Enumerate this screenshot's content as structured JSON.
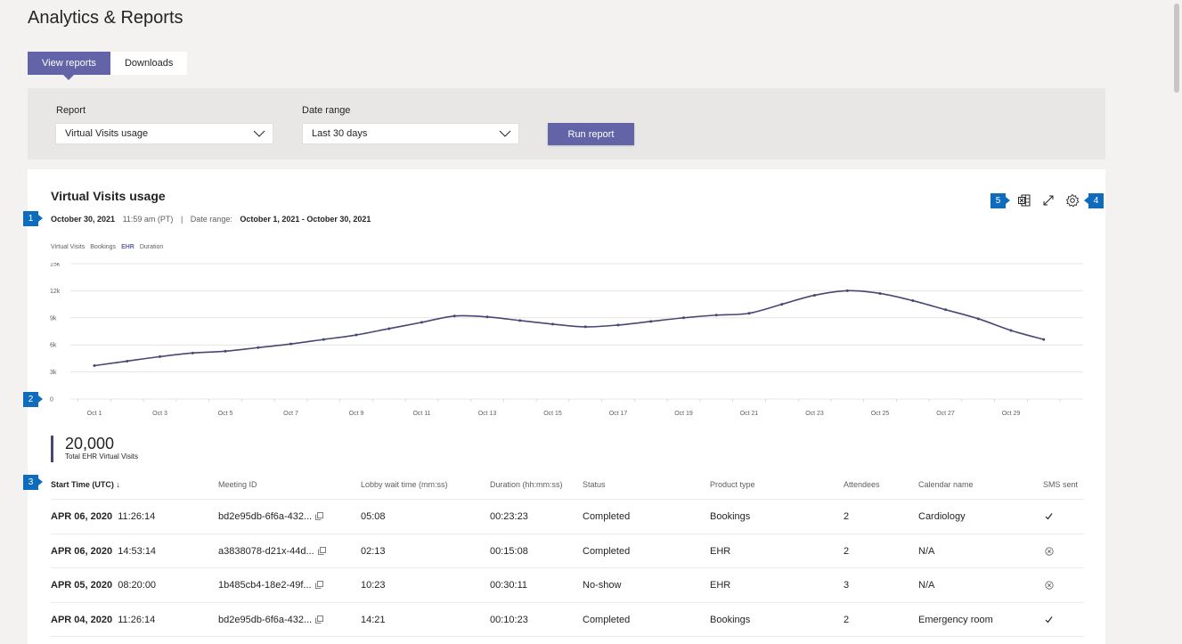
{
  "page": {
    "title": "Analytics & Reports"
  },
  "tabs": [
    {
      "label": "View reports",
      "active": true
    },
    {
      "label": "Downloads",
      "active": false
    }
  ],
  "filters": {
    "report_label": "Report",
    "report_value": "Virtual Visits usage",
    "date_label": "Date range",
    "date_value": "Last 30 days",
    "run_label": "Run report"
  },
  "card": {
    "title": "Virtual Visits usage",
    "date": "October 30, 2021",
    "time": "11:59 am (PT)",
    "range_label": "Date range:",
    "range_value": "October 1, 2021 - October 30, 2021",
    "icons": [
      "excel-icon",
      "expand-icon",
      "settings-icon"
    ]
  },
  "badges": [
    "1",
    "2",
    "3",
    "4",
    "5"
  ],
  "legend": [
    {
      "label": "Virtual Visits",
      "active": false
    },
    {
      "label": "Bookings",
      "active": false
    },
    {
      "label": "EHR",
      "active": true
    },
    {
      "label": "Duration",
      "active": false
    }
  ],
  "chart_data": {
    "type": "line",
    "ylim": [
      0,
      15000
    ],
    "yticks": [
      "15k",
      "12k",
      "9k",
      "6k",
      "3k",
      "0"
    ],
    "xticks": [
      "Oct 1",
      "Oct 3",
      "Oct 5",
      "Oct 7",
      "Oct 9",
      "Oct 11",
      "Oct 13",
      "Oct 15",
      "Oct 17",
      "Oct 19",
      "Oct 21",
      "Oct 23",
      "Oct 25",
      "Oct 27",
      "Oct 29"
    ],
    "series": [
      {
        "color": "#464775",
        "x": [
          1,
          2,
          3,
          4,
          5,
          6,
          7,
          8,
          9,
          10,
          11,
          12,
          13,
          14,
          15,
          16,
          17,
          18,
          19,
          20,
          21,
          22,
          23,
          24,
          25,
          26,
          27,
          28,
          29,
          30
        ],
        "values": [
          3700,
          4200,
          4700,
          5100,
          5300,
          5700,
          6100,
          6600,
          7100,
          7800,
          8500,
          9200,
          9100,
          8700,
          8300,
          8000,
          8200,
          8600,
          9000,
          9300,
          9500,
          10500,
          11500,
          12000,
          11700,
          10900,
          9900,
          8900,
          7600,
          6600
        ]
      }
    ]
  },
  "total": {
    "value": "20,000",
    "label": "Total EHR Virtual Visits"
  },
  "table": {
    "headers": [
      "Start Time (UTC) ↓",
      "Meeting ID",
      "Lobby wait time (mm:ss)",
      "Duration (hh:mm:ss)",
      "Status",
      "Product type",
      "Attendees",
      "Calendar name",
      "SMS sent"
    ],
    "rows": [
      {
        "date": "APR 06, 2020",
        "time": "11:26:14",
        "meeting_id": "bd2e95db-6f6a-432...",
        "lobby": "05:08",
        "duration": "00:23:23",
        "status": "Completed",
        "product": "Bookings",
        "attendees": "2",
        "calendar": "Cardiology",
        "sms": "check-icon"
      },
      {
        "date": "APR 06, 2020",
        "time": "14:53:14",
        "meeting_id": "a3838078-d21x-44d...",
        "lobby": "02:13",
        "duration": "00:15:08",
        "status": "Completed",
        "product": "EHR",
        "attendees": "2",
        "calendar": "N/A",
        "sms": "x-circle-icon"
      },
      {
        "date": "APR 05, 2020",
        "time": "08:20:00",
        "meeting_id": "1b485cb4-18e2-49f...",
        "lobby": "10:23",
        "duration": "00:30:11",
        "status": "No-show",
        "product": "EHR",
        "attendees": "3",
        "calendar": "N/A",
        "sms": "x-circle-icon"
      },
      {
        "date": "APR 04, 2020",
        "time": "11:26:14",
        "meeting_id": "bd2e95db-6f6a-432...",
        "lobby": "14:21",
        "duration": "00:10:23",
        "status": "Completed",
        "product": "Bookings",
        "attendees": "2",
        "calendar": "Emergency room",
        "sms": "check-icon"
      }
    ]
  }
}
